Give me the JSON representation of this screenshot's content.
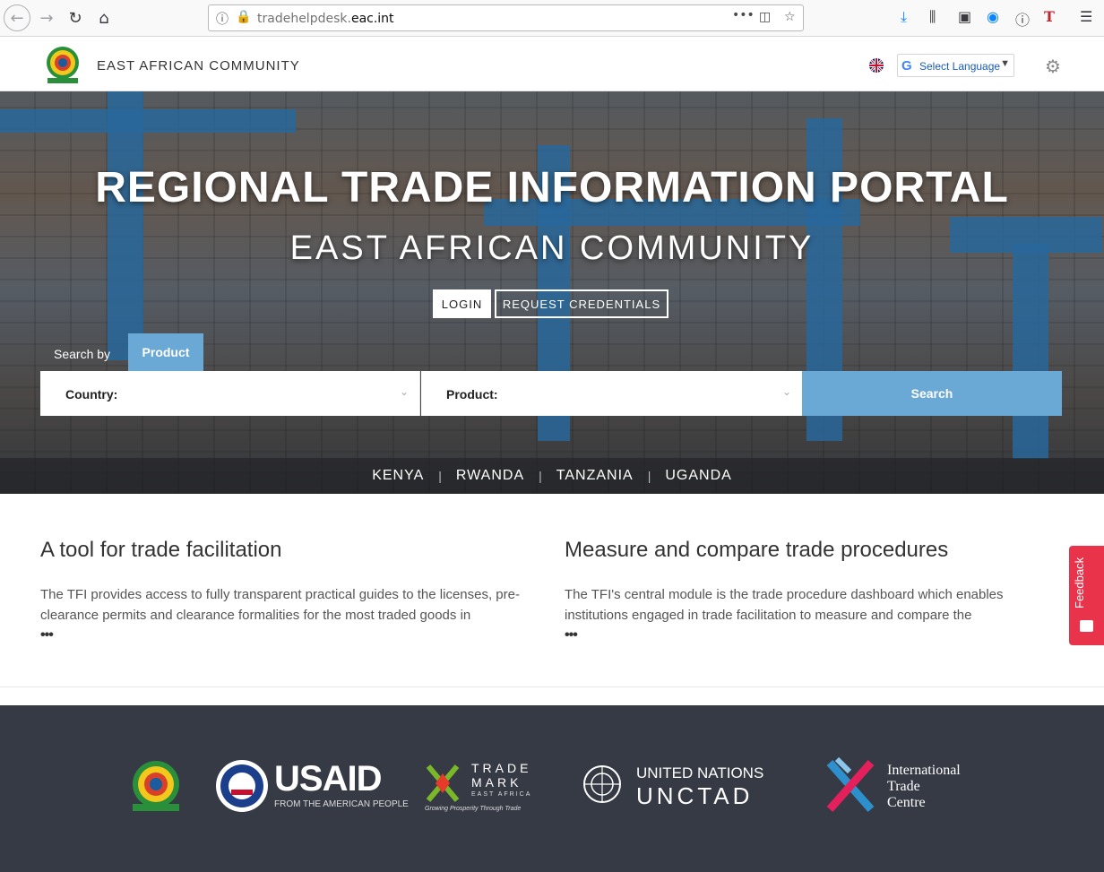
{
  "browser": {
    "url_prefix": "tradehelpdesk.",
    "url_domain": "eac.int",
    "page_actions": "•••"
  },
  "header": {
    "site_title": "EAST AFRICAN COMMUNITY",
    "language_select": "Select Language",
    "language_caret": "▼",
    "google_g": "G"
  },
  "hero": {
    "title": "REGIONAL TRADE INFORMATION PORTAL",
    "subtitle": "EAST AFRICAN COMMUNITY",
    "login_label": "LOGIN",
    "credentials_label": "REQUEST CREDENTIALS",
    "search_by_label": "Search by",
    "tab_product": "Product",
    "country_label": "Country:",
    "product_label": "Product:",
    "search_label": "Search",
    "countries": [
      "KENYA",
      "RWANDA",
      "TANZANIA",
      "UGANDA"
    ]
  },
  "content": {
    "left": {
      "heading": "A tool for trade facilitation",
      "text": "The TFI provides access to fully transparent practical guides to the licenses, pre-clearance permits and clearance formalities for the most traded goods in",
      "more": "•••"
    },
    "right": {
      "heading": "Measure and compare trade procedures",
      "text": "The TFI's central module is the trade procedure dashboard which enables institutions engaged in trade facilitation to measure and compare the",
      "more": "•••"
    }
  },
  "feedback": {
    "label": "Feedback"
  },
  "footer": {
    "usaid_main": "USAID",
    "usaid_tagline": "FROM THE AMERICAN PEOPLE",
    "trademark_line1": "TRADE",
    "trademark_line2": "MARK",
    "trademark_line3": "EAST AFRICA",
    "trademark_tagline": "Growing Prosperity Through Trade",
    "un_line1": "UNITED NATIONS",
    "un_line2": "UNCTAD",
    "itc_line1": "International",
    "itc_line2": "Trade",
    "itc_line3": "Centre"
  },
  "colors": {
    "accent": "#6aa8d6",
    "footer_bg": "#363a45",
    "feedback": "#e8334a",
    "usaid_red": "#c8102e"
  }
}
